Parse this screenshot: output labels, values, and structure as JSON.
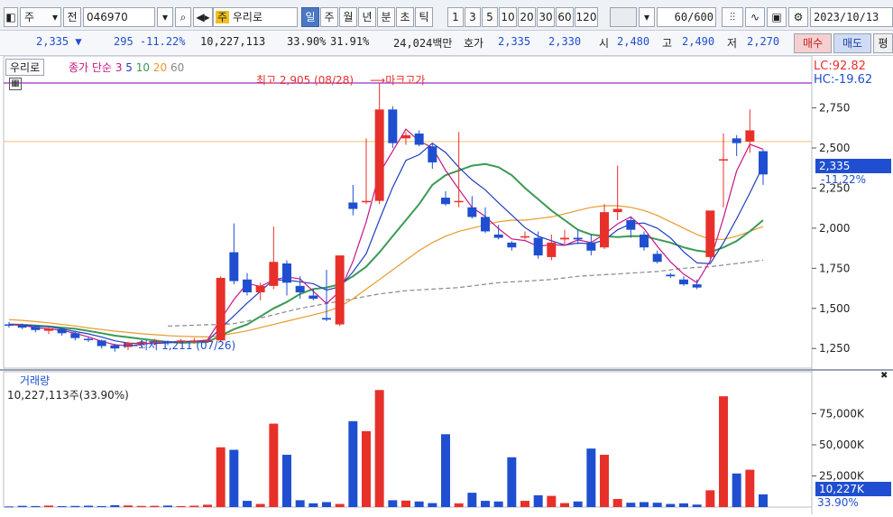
{
  "toolbar": {
    "market": "주",
    "prev_label": "전",
    "code": "046970",
    "name": "우리로",
    "name_tag": "주",
    "periods": [
      "일",
      "주",
      "월",
      "년",
      "분",
      "초",
      "틱"
    ],
    "active_period": "일",
    "intervals": [
      "1",
      "3",
      "5",
      "10",
      "20",
      "30",
      "60",
      "120"
    ],
    "count": "60",
    "count_total": "/600",
    "date": "2023/10/13"
  },
  "quote": {
    "price": "2,335",
    "direction": "▼",
    "change": "295",
    "change_pct": "-11.22%",
    "volume": "10,227,113",
    "turnover_pct": "33.90%",
    "extra_pct": "31.91%",
    "amount": "24,024백만",
    "hoga_label": "호가",
    "ask": "2,335",
    "bid": "2,330",
    "open_label": "시",
    "open": "2,480",
    "high_label": "고",
    "high": "2,490",
    "low_label": "저",
    "low": "2,270",
    "buy_label": "매수",
    "sell_label": "매도",
    "eval_label": "평"
  },
  "price_panel": {
    "name_box": "우리로",
    "ma_title": "종가 단순",
    "ma_periods": [
      "3",
      "5",
      "10",
      "20",
      "60"
    ],
    "lc_label": "LC:92.82",
    "hc_label": "HC:-19.62",
    "high_note": "최고 2,905 (08/28)",
    "high_marker": "마크고가",
    "low_note": "최저 1,211 (07/26)",
    "current_price": "2,335",
    "current_pct": "-11.22%",
    "y_ticks": [
      "2,750",
      "2,500",
      "2,250",
      "2,000",
      "1,750",
      "1,500",
      "1,250"
    ],
    "high_line_value": 2905,
    "ref_line_value": 2540
  },
  "volume_panel": {
    "title": "거래량",
    "value_text": "10,227,113주(33.90%)",
    "y_ticks": [
      "75,000K",
      "50,000K",
      "25,000K"
    ],
    "current": "10,227K",
    "current_pct": "33.90%"
  },
  "colors": {
    "up": "#e8302a",
    "down": "#1f4fd0",
    "ma3": "#c71585",
    "ma5": "#1e3fbf",
    "ma10": "#3a9a55",
    "ma20": "#e89a2c",
    "ma60": "#888888",
    "accent": "#4a78c4"
  },
  "chart_data": {
    "type": "candlestick",
    "y_range": [
      1150,
      2950
    ],
    "volume_range_k": [
      0,
      100000
    ],
    "candles": [
      [
        1400,
        1415,
        1380,
        1395
      ],
      [
        1395,
        1405,
        1370,
        1380
      ],
      [
        1385,
        1390,
        1350,
        1365
      ],
      [
        1360,
        1380,
        1340,
        1375
      ],
      [
        1370,
        1375,
        1330,
        1345
      ],
      [
        1345,
        1360,
        1300,
        1315
      ],
      [
        1310,
        1320,
        1290,
        1305
      ],
      [
        1300,
        1305,
        1250,
        1265
      ],
      [
        1270,
        1280,
        1230,
        1250
      ],
      [
        1260,
        1290,
        1240,
        1285
      ],
      [
        1280,
        1300,
        1260,
        1290
      ],
      [
        1290,
        1310,
        1270,
        1295
      ],
      [
        1295,
        1300,
        1270,
        1285
      ],
      [
        1290,
        1310,
        1280,
        1300
      ],
      [
        1295,
        1315,
        1280,
        1300
      ],
      [
        1300,
        1310,
        1285,
        1305
      ],
      [
        1300,
        1700,
        1290,
        1690
      ],
      [
        1850,
        2030,
        1650,
        1670
      ],
      [
        1680,
        1720,
        1580,
        1600
      ],
      [
        1600,
        1660,
        1550,
        1640
      ],
      [
        1640,
        2010,
        1620,
        1790
      ],
      [
        1780,
        1800,
        1580,
        1660
      ],
      [
        1640,
        1700,
        1560,
        1600
      ],
      [
        1580,
        1620,
        1550,
        1560
      ],
      [
        1440,
        1740,
        1420,
        1430
      ],
      [
        1400,
        1830,
        1390,
        1830
      ],
      [
        2160,
        2270,
        2080,
        2120
      ],
      [
        2170,
        2560,
        2150,
        2170
      ],
      [
        2170,
        2905,
        2150,
        2740
      ],
      [
        2740,
        2760,
        2500,
        2530
      ],
      [
        2560,
        2600,
        2520,
        2580
      ],
      [
        2590,
        2610,
        2510,
        2520
      ],
      [
        2510,
        2530,
        2370,
        2410
      ],
      [
        2190,
        2230,
        2140,
        2150
      ],
      [
        2170,
        2600,
        2130,
        2170
      ],
      [
        2130,
        2200,
        2060,
        2070
      ],
      [
        2070,
        2130,
        1970,
        1980
      ],
      [
        1960,
        2020,
        1930,
        1940
      ],
      [
        1910,
        1920,
        1860,
        1880
      ],
      [
        1950,
        1980,
        1930,
        1950
      ],
      [
        1940,
        1980,
        1810,
        1830
      ],
      [
        1820,
        1960,
        1800,
        1910
      ],
      [
        1930,
        1990,
        1900,
        1940
      ],
      [
        1940,
        1990,
        1900,
        1930
      ],
      [
        1910,
        1960,
        1830,
        1860
      ],
      [
        1880,
        2150,
        1870,
        2100
      ],
      [
        2100,
        2390,
        2050,
        2120
      ],
      [
        2050,
        2070,
        1940,
        1990
      ],
      [
        1960,
        1980,
        1860,
        1880
      ],
      [
        1840,
        1860,
        1780,
        1790
      ],
      [
        1710,
        1720,
        1690,
        1700
      ],
      [
        1680,
        1700,
        1640,
        1650
      ],
      [
        1650,
        1680,
        1620,
        1630
      ],
      [
        1820,
        2100,
        1810,
        2110
      ],
      [
        2430,
        2590,
        2130,
        2430
      ],
      [
        2560,
        2580,
        2450,
        2530
      ],
      [
        2540,
        2740,
        2470,
        2610
      ],
      [
        2480,
        2490,
        2270,
        2335
      ]
    ],
    "volumes_k": [
      500,
      1000,
      800,
      1200,
      700,
      900,
      1100,
      800,
      1500,
      1300,
      900,
      1000,
      1200,
      800,
      1100,
      1900,
      48000,
      46000,
      5000,
      2500,
      67000,
      42000,
      5500,
      3000,
      4000,
      2500,
      69000,
      61000,
      94000,
      5500,
      5200,
      4500,
      3200,
      58500,
      3000,
      11500,
      5000,
      4500,
      40000,
      5000,
      9500,
      9000,
      3200,
      4500,
      47000,
      42000,
      6500,
      3500,
      4000,
      3500,
      2500,
      3000,
      2000,
      13500,
      89000,
      27000,
      30000,
      10227
    ],
    "ma3": [
      1400,
      1395,
      1380,
      1373,
      1362,
      1345,
      1322,
      1295,
      1273,
      1267,
      1275,
      1290,
      1290,
      1293,
      1295,
      1302,
      1432,
      1555,
      1655,
      1637,
      1677,
      1697,
      1683,
      1607,
      1530,
      1607,
      1793,
      2040,
      2343,
      2480,
      2617,
      2543,
      2503,
      2360,
      2243,
      2130,
      2073,
      1997,
      1933,
      1923,
      1887,
      1897,
      1893,
      1927,
      1910,
      1963,
      2027,
      2070,
      1997,
      1887,
      1790,
      1713,
      1660,
      1797,
      2063,
      2357,
      2523,
      2492
    ],
    "ma5": [
      1400,
      1395,
      1390,
      1385,
      1372,
      1356,
      1341,
      1321,
      1298,
      1284,
      1280,
      1281,
      1285,
      1293,
      1295,
      1297,
      1376,
      1453,
      1533,
      1607,
      1678,
      1676,
      1666,
      1654,
      1614,
      1635,
      1727,
      1841,
      2053,
      2254,
      2423,
      2458,
      2530,
      2472,
      2379,
      2301,
      2239,
      2158,
      2082,
      2004,
      1950,
      1922,
      1895,
      1907,
      1903,
      1925,
      1990,
      2027,
      2032,
      2000,
      1940,
      1852,
      1784,
      1779,
      1908,
      2059,
      2219,
      2390
    ],
    "ma10": [
      1400,
      1398,
      1393,
      1388,
      1380,
      1373,
      1360,
      1345,
      1330,
      1320,
      1310,
      1300,
      1290,
      1285,
      1288,
      1290,
      1330,
      1370,
      1400,
      1450,
      1500,
      1540,
      1590,
      1620,
      1630,
      1650,
      1700,
      1760,
      1850,
      1950,
      2050,
      2150,
      2270,
      2330,
      2360,
      2390,
      2400,
      2380,
      2330,
      2250,
      2180,
      2110,
      2050,
      1990,
      1960,
      1950,
      1945,
      1950,
      1950,
      1930,
      1910,
      1880,
      1860,
      1850,
      1880,
      1920,
      1980,
      2050
    ],
    "ma20": [
      1430,
      1425,
      1418,
      1410,
      1400,
      1390,
      1378,
      1368,
      1358,
      1350,
      1342,
      1336,
      1330,
      1326,
      1324,
      1322,
      1330,
      1345,
      1360,
      1380,
      1400,
      1420,
      1440,
      1460,
      1480,
      1510,
      1560,
      1620,
      1680,
      1740,
      1800,
      1860,
      1910,
      1950,
      1980,
      2000,
      2020,
      2040,
      2050,
      2050,
      2060,
      2070,
      2090,
      2110,
      2130,
      2140,
      2140,
      2130,
      2110,
      2080,
      2040,
      2000,
      1960,
      1930,
      1930,
      1950,
      1980,
      2010
    ],
    "ma60": [
      null,
      null,
      null,
      null,
      null,
      null,
      null,
      null,
      null,
      null,
      null,
      null,
      1390,
      1392,
      1395,
      1398,
      1400,
      1405,
      1420,
      1440,
      1460,
      1480,
      1500,
      1515,
      1530,
      1545,
      1560,
      1575,
      1590,
      1600,
      1610,
      1615,
      1620,
      1625,
      1630,
      1640,
      1650,
      1660,
      1665,
      1670,
      1675,
      1680,
      1690,
      1700,
      1705,
      1710,
      1715,
      1720,
      1725,
      1730,
      1740,
      1750,
      1755,
      1760,
      1770,
      1780,
      1790,
      1800
    ]
  }
}
